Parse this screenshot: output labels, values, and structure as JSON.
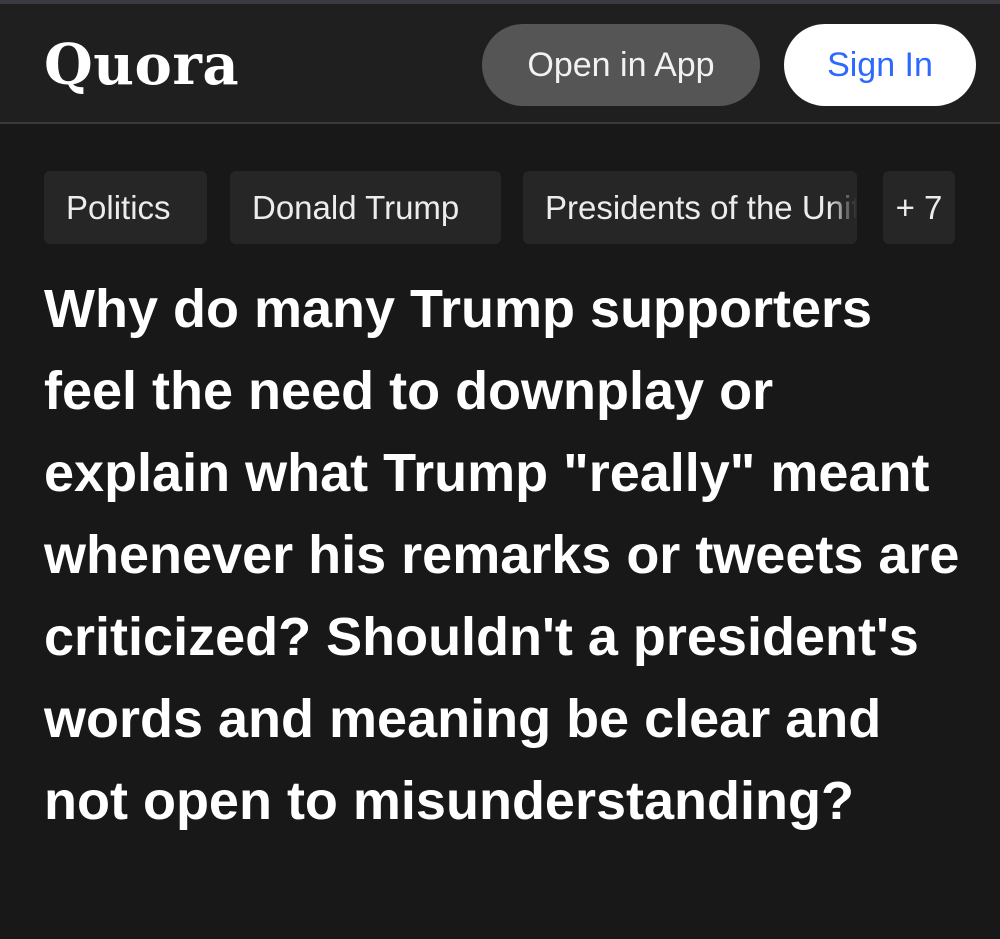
{
  "header": {
    "logo": "Quora",
    "open_in_app_label": "Open in App",
    "sign_in_label": "Sign In"
  },
  "topics": [
    {
      "label": "Politics"
    },
    {
      "label": "Donald Trump"
    },
    {
      "label": "Presidents of the United States"
    },
    {
      "label": "+ 7"
    }
  ],
  "question": {
    "title": "Why do many Trump supporters feel the need to downplay or explain what Trump \"really\" meant whenever his remarks or tweets are criticized? Shouldn't a president's words and meaning be clear and not open to misunderstanding?"
  },
  "colors": {
    "background": "#181818",
    "header_background": "#1f1f1f",
    "chip_background": "#262626",
    "open_button": "#555555",
    "sign_in_text": "#2e69ff"
  }
}
